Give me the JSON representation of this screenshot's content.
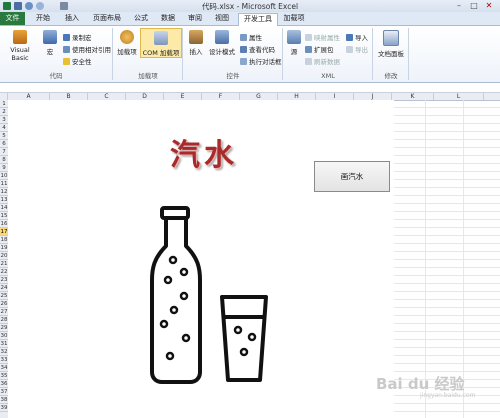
{
  "window": {
    "title": "代码.xlsx - Microsoft Excel"
  },
  "tabs": [
    "文件",
    "开始",
    "插入",
    "页面布局",
    "公式",
    "数据",
    "审阅",
    "视图",
    "开发工具",
    "加载项"
  ],
  "ribbon": {
    "groups": [
      {
        "label": "代码",
        "buttons": [
          "Visual Basic",
          "宏"
        ],
        "small": [
          "录制宏",
          "使用相对引用",
          "安全性"
        ]
      },
      {
        "label": "加载项",
        "buttons": [
          "加载项",
          "COM 加载项"
        ]
      },
      {
        "label": "控件",
        "buttons": [
          "插入",
          "设计模式"
        ],
        "small": [
          "属性",
          "查看代码",
          "执行对话框"
        ]
      },
      {
        "label": "XML",
        "buttons": [
          "源"
        ],
        "small": [
          "映射属性",
          "扩展包",
          "刷新数据",
          "导入",
          "导出"
        ]
      },
      {
        "label": "修改",
        "buttons": [
          "文档面板"
        ]
      }
    ]
  },
  "columns": [
    "A",
    "B",
    "C",
    "D",
    "E",
    "F",
    "G",
    "H",
    "I",
    "J",
    "K",
    "L"
  ],
  "rows": [
    "1",
    "2",
    "3",
    "4",
    "5",
    "6",
    "7",
    "8",
    "9",
    "10",
    "11",
    "12",
    "13",
    "14",
    "15",
    "16",
    "17",
    "18",
    "19",
    "20",
    "21",
    "22",
    "23",
    "24",
    "25",
    "26",
    "27",
    "28",
    "29",
    "30",
    "31",
    "32",
    "33",
    "34",
    "35",
    "36",
    "37",
    "38",
    "39"
  ],
  "selected_row": "17",
  "sheet": {
    "heading": "汽水",
    "button_label": "画汽水"
  },
  "watermark": {
    "text": "Bai du 经验",
    "sub": "jingyan.baidu.com"
  },
  "colors": {
    "file_tab": "#2a7a3f",
    "heading": "#a82a2a",
    "selected_row": "#f9d77c"
  }
}
